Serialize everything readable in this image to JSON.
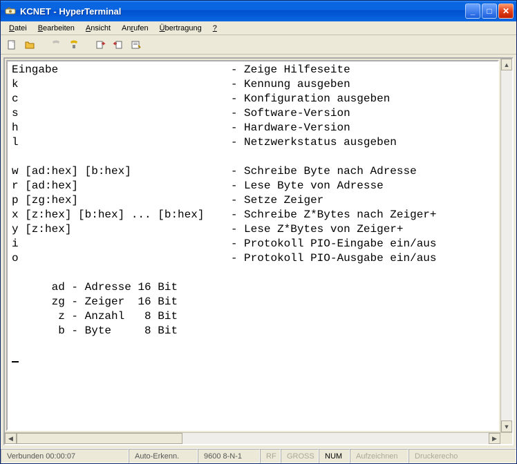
{
  "title": "KCNET - HyperTerminal",
  "menu": [
    "Datei",
    "Bearbeiten",
    "Ansicht",
    "Anrufen",
    "Übertragung",
    "?"
  ],
  "toolbar": [
    {
      "name": "new-icon"
    },
    {
      "name": "open-icon"
    },
    {
      "name": "phone-icon",
      "disabled": true
    },
    {
      "name": "hangup-icon"
    },
    {
      "name": "send-icon"
    },
    {
      "name": "receive-icon"
    },
    {
      "name": "properties-icon"
    }
  ],
  "terminal_lines": [
    "Eingabe                          - Zeige Hilfeseite",
    "k                                - Kennung ausgeben",
    "c                                - Konfiguration ausgeben",
    "s                                - Software-Version",
    "h                                - Hardware-Version",
    "l                                - Netzwerkstatus ausgeben",
    "",
    "w [ad:hex] [b:hex]               - Schreibe Byte nach Adresse",
    "r [ad:hex]                       - Lese Byte von Adresse",
    "p [zg:hex]                       - Setze Zeiger",
    "x [z:hex] [b:hex] ... [b:hex]    - Schreibe Z*Bytes nach Zeiger+",
    "y [z:hex]                        - Lese Z*Bytes von Zeiger+",
    "i                                - Protokoll PIO-Eingabe ein/aus",
    "o                                - Protokoll PIO-Ausgabe ein/aus",
    "",
    "      ad - Adresse 16 Bit",
    "      zg - Zeiger  16 Bit",
    "       z - Anzahl   8 Bit",
    "       b - Byte     8 Bit",
    ""
  ],
  "statusbar": {
    "connected": "Verbunden 00:00:07",
    "autodetect": "Auto-Erkenn.",
    "port": "9600 8-N-1",
    "rf": "RF",
    "caps": "GROSS",
    "num": "NUM",
    "record": "Aufzeichnen",
    "printecho": "Druckerecho"
  }
}
